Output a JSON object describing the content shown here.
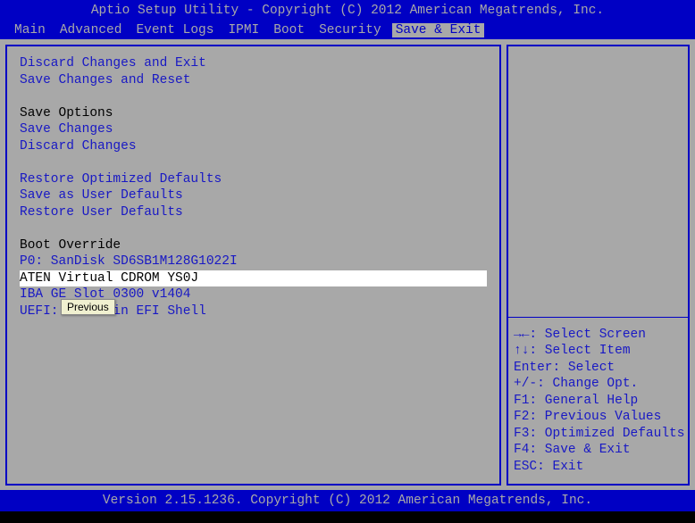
{
  "title": "Aptio Setup Utility - Copyright (C) 2012 American Megatrends, Inc.",
  "footer": "Version 2.15.1236. Copyright (C) 2012 American Megatrends, Inc.",
  "tabs": [
    {
      "label": "Main"
    },
    {
      "label": "Advanced"
    },
    {
      "label": "Event Logs"
    },
    {
      "label": "IPMI"
    },
    {
      "label": "Boot"
    },
    {
      "label": "Security"
    },
    {
      "label": "Save & Exit"
    }
  ],
  "menu": {
    "items": [
      {
        "label": "Discard Changes and Exit",
        "type": "item"
      },
      {
        "label": "Save Changes and Reset",
        "type": "item"
      },
      {
        "label": "",
        "type": "empty"
      },
      {
        "label": "Save Options",
        "type": "header"
      },
      {
        "label": "Save Changes",
        "type": "item"
      },
      {
        "label": "Discard Changes",
        "type": "item"
      },
      {
        "label": "",
        "type": "empty"
      },
      {
        "label": "Restore Optimized Defaults",
        "type": "item"
      },
      {
        "label": "Save as User Defaults",
        "type": "item"
      },
      {
        "label": "Restore User Defaults",
        "type": "item"
      },
      {
        "label": "",
        "type": "empty"
      },
      {
        "label": "Boot Override",
        "type": "header"
      },
      {
        "label": "P0: SanDisk SD6SB1M128G1022I",
        "type": "item"
      },
      {
        "label": "ATEN Virtual CDROM YS0J",
        "type": "selected"
      },
      {
        "label": "IBA GE Slot 0300 v1404",
        "type": "item"
      },
      {
        "label": "UEFI: Built-in EFI Shell",
        "type": "item"
      }
    ]
  },
  "help": {
    "arrows_lr": "→←",
    "arrows_ud": "↑↓",
    "select_screen": ": Select Screen",
    "select_item": ": Select Item",
    "enter": "Enter: Select",
    "plusminus": "+/-: Change Opt.",
    "f1": "F1: General Help",
    "f2": "F2: Previous Values",
    "f3": "F3: Optimized Defaults",
    "f4": "F4: Save & Exit",
    "esc": "ESC: Exit"
  },
  "tooltip": "Previous"
}
